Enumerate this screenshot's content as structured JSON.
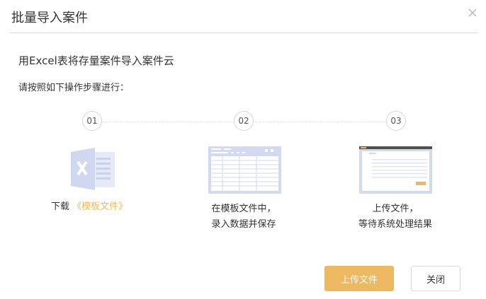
{
  "dialog": {
    "title": "批量导入案件",
    "lead": "用Excel表将存量案件导入案件云",
    "instruction": "请按照如下操作步骤进行：",
    "steps": [
      {
        "number": "01",
        "text_prefix": "下载",
        "link": "《模板文件》"
      },
      {
        "number": "02",
        "line1": "在模板文件中，",
        "line2": "录入数据并保存"
      },
      {
        "number": "03",
        "line1": "上传文件，",
        "line2": "等待系统处理结果"
      }
    ],
    "buttons": {
      "upload": "上传文件",
      "close": "关闭"
    }
  },
  "colors": {
    "accent": "#edb862",
    "link": "#f0b95d",
    "icon_blue": "#d0d7f0"
  },
  "icons": [
    "close-icon",
    "excel-icon",
    "spreadsheet-icon",
    "upload-window-icon"
  ]
}
